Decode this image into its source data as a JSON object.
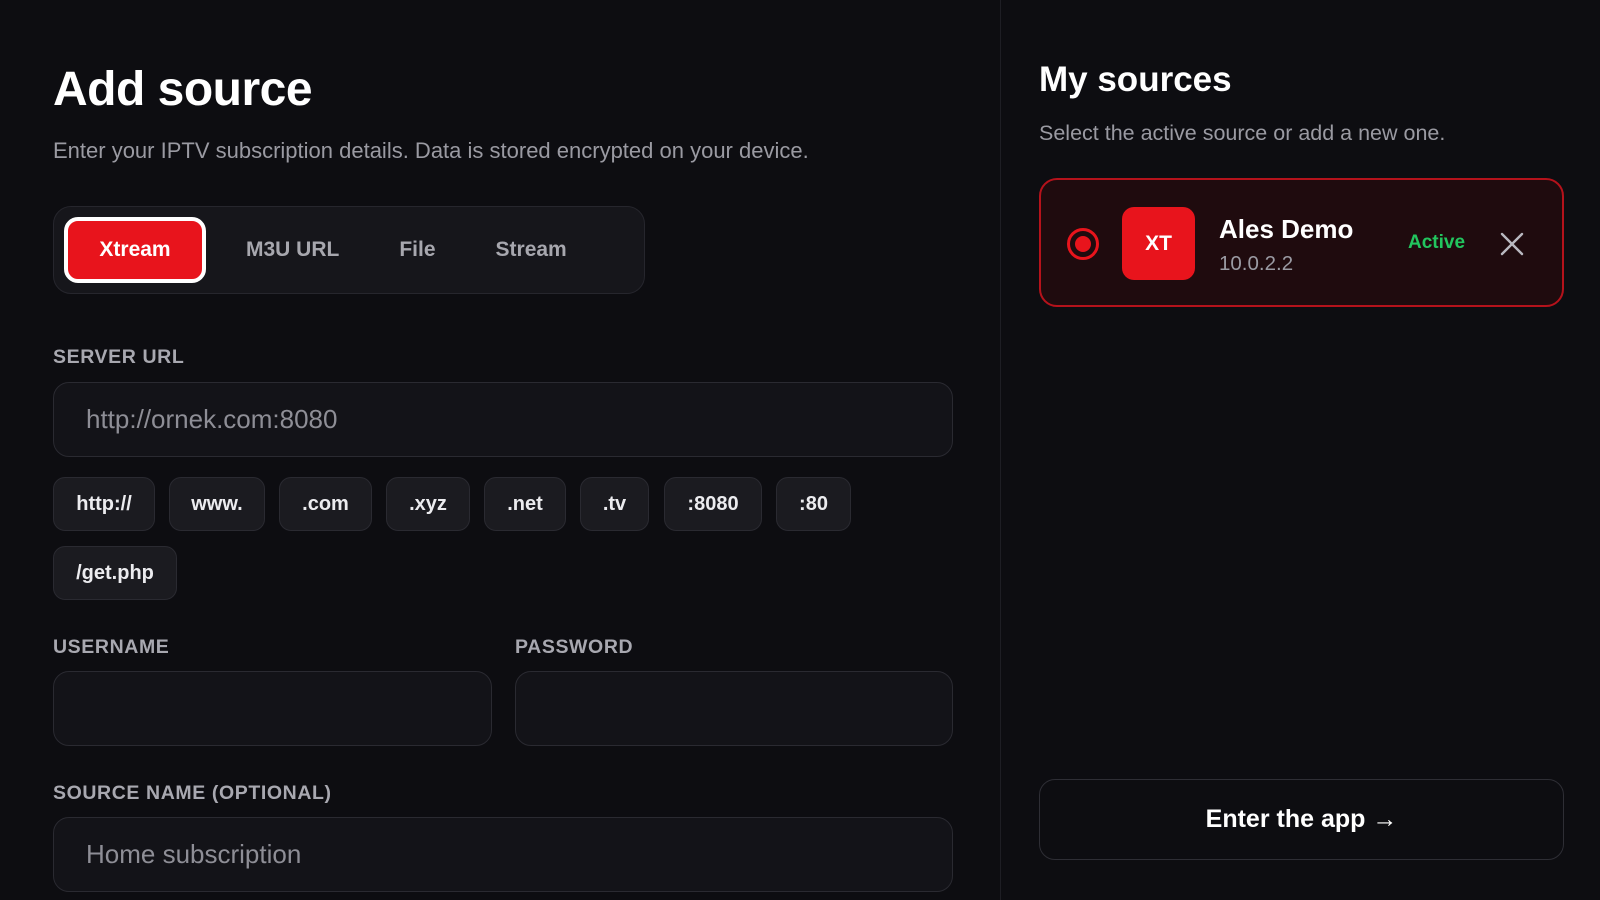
{
  "add_source": {
    "title": "Add source",
    "subtitle": "Enter your IPTV subscription details. Data is stored encrypted on your device.",
    "tabs": [
      {
        "label": "Xtream",
        "active": true
      },
      {
        "label": "M3U URL",
        "active": false
      },
      {
        "label": "File",
        "active": false
      },
      {
        "label": "Stream",
        "active": false
      }
    ],
    "server_url": {
      "label": "SERVER URL",
      "placeholder": "http://ornek.com:8080",
      "value": ""
    },
    "url_chips": [
      "http://",
      "www.",
      ".com",
      ".xyz",
      ".net",
      ".tv",
      ":8080",
      ":80",
      "/get.php"
    ],
    "username": {
      "label": "USERNAME",
      "value": "",
      "placeholder": ""
    },
    "password": {
      "label": "PASSWORD",
      "value": "",
      "placeholder": ""
    },
    "source_name": {
      "label": "SOURCE NAME (OPTIONAL)",
      "placeholder": "Home subscription",
      "value": ""
    }
  },
  "my_sources": {
    "title": "My sources",
    "subtitle": "Select the active source or add a new one.",
    "items": [
      {
        "badge": "XT",
        "name": "Ales Demo",
        "host": "10.0.2.2",
        "status": "Active",
        "selected": true
      }
    ],
    "enter_button": "Enter the app →"
  },
  "colors": {
    "accent": "#e8141c",
    "active_status": "#22c55e",
    "background": "#0d0d11",
    "card_background": "#1f0b0e"
  },
  "icons": {
    "radio": "radio-selected-icon",
    "remove": "close-icon"
  }
}
